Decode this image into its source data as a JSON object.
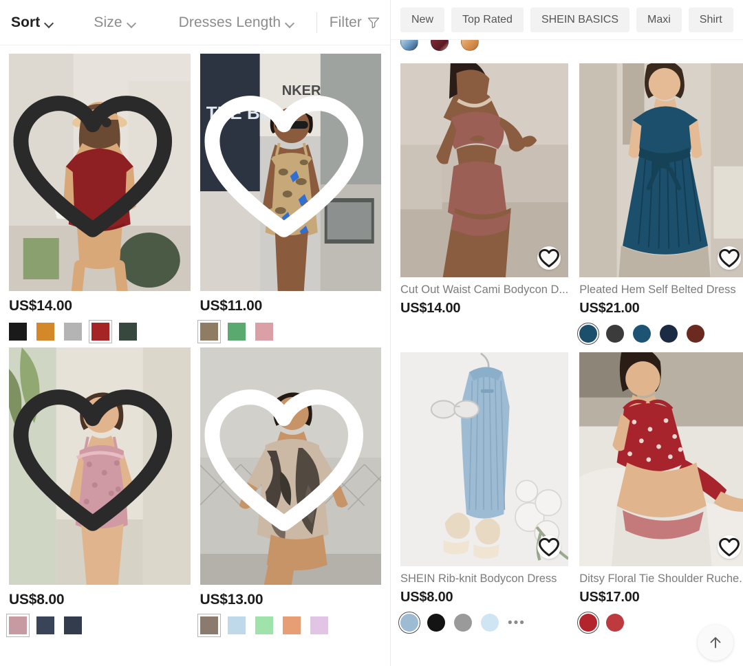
{
  "left_panel": {
    "header": {
      "sort": {
        "label": "Sort",
        "icon": "chevron-down-icon",
        "active": true
      },
      "size": {
        "label": "Size",
        "icon": "chevron-down-icon",
        "active": false
      },
      "dresses_length": {
        "label": "Dresses Length",
        "icon": "chevron-down-icon",
        "active": false
      },
      "filter": {
        "label": "Filter",
        "icon": "funnel-icon"
      }
    },
    "products": [
      {
        "price": "US$14.00",
        "wishlist_icon": "heart-outline-icon",
        "image_alt": "Woman in red short-sleeve bodycon dress with straw hat and coffee",
        "swatches": [
          {
            "name": "black",
            "color": "#1a1a1a",
            "selected": false
          },
          {
            "name": "mustard",
            "color": "#d4882a",
            "selected": false
          },
          {
            "name": "grey",
            "color": "#b4b4b4",
            "selected": false
          },
          {
            "name": "red",
            "color": "#a62424",
            "selected": true
          },
          {
            "name": "dark-green",
            "color": "#37493f",
            "selected": false
          }
        ]
      },
      {
        "price": "US$11.00",
        "wishlist_icon": "heart-outline-icon",
        "image_alt": "Woman in leopard butterfly print cami dress against poster wall",
        "swatches": [
          {
            "name": "leopard-print",
            "color": "#8e7d63",
            "selected": true
          },
          {
            "name": "green",
            "color": "#5aa96f",
            "selected": false
          },
          {
            "name": "pink",
            "color": "#dba0a6",
            "selected": false
          }
        ]
      },
      {
        "price": "US$8.00",
        "wishlist_icon": "heart-outline-icon",
        "image_alt": "Woman in pink floral cami bodycon dress outdoors",
        "swatches": [
          {
            "name": "pink-floral",
            "color": "#c79aa2",
            "selected": true
          },
          {
            "name": "navy-print",
            "color": "#3a4458",
            "selected": false
          },
          {
            "name": "dark-print",
            "color": "#333c4d",
            "selected": false
          }
        ]
      },
      {
        "price": "US$13.00",
        "wishlist_icon": "heart-outline-icon",
        "image_alt": "Woman in tie-dye oversized tee dress by chain link fence",
        "swatches": [
          {
            "name": "tie-dye-photo",
            "color": "#8a7b6e",
            "selected": true
          },
          {
            "name": "light-blue",
            "color": "#bfd9ea",
            "selected": false
          },
          {
            "name": "mint-green",
            "color": "#9fe3ab",
            "selected": false
          },
          {
            "name": "peach",
            "color": "#e79e74",
            "selected": false
          },
          {
            "name": "lilac",
            "color": "#e2c4e4",
            "selected": false
          }
        ]
      }
    ]
  },
  "right_panel": {
    "chips": [
      {
        "label": "New"
      },
      {
        "label": "Top Rated"
      },
      {
        "label": "SHEIN BASICS"
      },
      {
        "label": "Maxi"
      },
      {
        "label": "Shirt"
      }
    ],
    "clipped_swatches": [
      {
        "name": "blue-white-print",
        "color": "#8fb6d4"
      },
      {
        "name": "dark-red-print",
        "color": "#6e2230"
      },
      {
        "name": "tan-print",
        "color": "#d79a5e"
      }
    ],
    "products": [
      {
        "title": "Cut Out Waist Cami Bodycon D...",
        "price": "US$14.00",
        "wishlist_icon": "heart-outline-icon",
        "image_alt": "Woman in rust cut-out waist cami bodycon dress",
        "swatches": []
      },
      {
        "title": "Pleated Hem Self Belted Dress",
        "price": "US$21.00",
        "wishlist_icon": "heart-outline-icon",
        "image_alt": "Woman in teal blue pleated hem self belted dress",
        "swatches": [
          {
            "name": "teal-blue",
            "color": "#1c4f6b",
            "selected": true
          },
          {
            "name": "charcoal",
            "color": "#3b3b3b",
            "selected": false
          },
          {
            "name": "steel-blue",
            "color": "#1d5373",
            "selected": false
          },
          {
            "name": "navy",
            "color": "#1c2b44",
            "selected": false
          },
          {
            "name": "maroon",
            "color": "#6b2a20",
            "selected": false
          }
        ]
      },
      {
        "title": "SHEIN Rib-knit Bodycon Dress",
        "price": "US$8.00",
        "wishlist_icon": "heart-outline-icon",
        "image_alt": "Light blue rib-knit bodycon dress flat lay with sunglasses and flowers",
        "swatches": [
          {
            "name": "light-blue-rib",
            "color": "#9dbcd4",
            "selected": true
          },
          {
            "name": "black",
            "color": "#141414",
            "selected": false
          },
          {
            "name": "grey",
            "color": "#9a9a9a",
            "selected": false
          },
          {
            "name": "pale-blue",
            "color": "#cfe5f4",
            "selected": false
          }
        ],
        "more_label": "•••"
      },
      {
        "title": "Ditsy Floral Tie Shoulder Ruche...",
        "price": "US$17.00",
        "wishlist_icon": "heart-outline-icon",
        "image_alt": "Woman in red ditsy floral tie shoulder ruched dress on bed",
        "swatches": [
          {
            "name": "red-floral",
            "color": "#b3242c",
            "selected": true
          },
          {
            "name": "red-floral-alt",
            "color": "#bd3a3f",
            "selected": false
          }
        ]
      }
    ],
    "scroll_to_top": {
      "icon": "arrow-up-icon"
    }
  }
}
